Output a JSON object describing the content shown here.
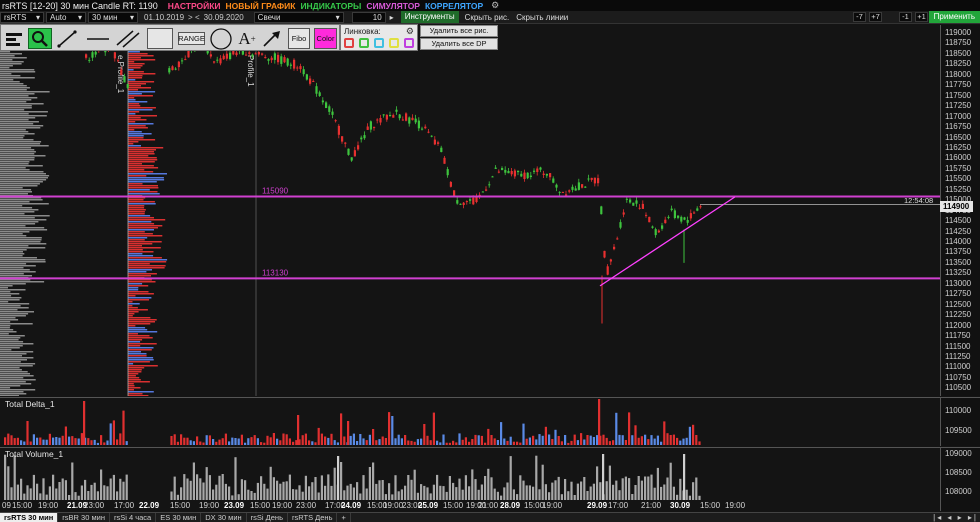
{
  "window": {
    "title": "rsRTS [12-20] 30 мин Candle RT: 1190",
    "menus": [
      {
        "label": "НАСТРОЙКИ",
        "color": "#ff4a8a"
      },
      {
        "label": "НОВЫЙ ГРАФИК",
        "color": "#ff8c1a"
      },
      {
        "label": "ИНДИКАТОРЫ",
        "color": "#36c94a"
      },
      {
        "label": "СИМУЛЯТОР",
        "color": "#d85ad8"
      },
      {
        "label": "КОРРЕЛЯТОР",
        "color": "#3ea6ff"
      }
    ]
  },
  "toolbar": {
    "symbol": "rsRTS",
    "scale_mode": "Auto",
    "timeframe": "30 мин",
    "date_from": "01.10.2019",
    "date_nav": "> <",
    "date_to": "30.09.2020",
    "chart_type": "Свечи",
    "bars_value": "10",
    "tools_button": "Инструменты",
    "hide_drawing": "Скрыть рис.",
    "hide_lines": "Скрыть линии",
    "btn_minus7": "-7",
    "btn_plus7": "+7",
    "btn_minus1": "-1",
    "btn_plus1": "+1",
    "apply_button": "Применить"
  },
  "drawing_panel": {
    "range_label": "RANGE",
    "fibo_label": "Fibo",
    "color_label": "Color",
    "link_title": "Линковка:",
    "link_colors": [
      "#e04040",
      "#40c040",
      "#40c0e0",
      "#e0e040",
      "#c040e0"
    ],
    "delete_drawings": "Удалить все рис.",
    "delete_dp": "Удалить все DP"
  },
  "main_chart": {
    "price_levels": [
      {
        "price": 115090,
        "label": "115090",
        "color": "#d040d0"
      },
      {
        "price": 113130,
        "label": "113130",
        "color": "#d040d0"
      }
    ],
    "current_price": "114900",
    "current_time": "12:54:08",
    "profile_labels": [
      "e Profile_1",
      "Profile_1"
    ],
    "y_ticks": [
      "119000",
      "118750",
      "118500",
      "118250",
      "118000",
      "117750",
      "117500",
      "117250",
      "117000",
      "116750",
      "116500",
      "116250",
      "116000",
      "115750",
      "115500",
      "115250",
      "115000",
      "114750",
      "114500",
      "114250",
      "114000",
      "113750",
      "113500",
      "113250",
      "113000",
      "112750",
      "112500",
      "112250",
      "112000",
      "111750",
      "111500",
      "111250",
      "111000",
      "110750",
      "110500"
    ],
    "up_color": "#3ec43e",
    "down_color": "#e83030"
  },
  "delta_pane": {
    "label": "Total Delta_1",
    "y_ticks": [
      "110000",
      "109500"
    ]
  },
  "volume_pane": {
    "label": "Total Volume_1",
    "y_ticks": [
      "109000",
      "108500",
      "108000"
    ]
  },
  "time_axis": {
    "labels": [
      {
        "text": "09",
        "day": false
      },
      {
        "text": "15:00",
        "day": false
      },
      {
        "text": "19:00",
        "day": false
      },
      {
        "text": "21.09",
        "day": true
      },
      {
        "text": "23:00",
        "day": false
      },
      {
        "text": "17:00",
        "day": false
      },
      {
        "text": "22.09",
        "day": true
      },
      {
        "text": "15:00",
        "day": false
      },
      {
        "text": "19:00",
        "day": false
      },
      {
        "text": "23.09",
        "day": true
      },
      {
        "text": "15:00",
        "day": false
      },
      {
        "text": "19:00",
        "day": false
      },
      {
        "text": "23:00",
        "day": false
      },
      {
        "text": "17:00",
        "day": false
      },
      {
        "text": "24.09",
        "day": true
      },
      {
        "text": "15:00",
        "day": false
      },
      {
        "text": "19:00",
        "day": false
      },
      {
        "text": "23:00",
        "day": false
      },
      {
        "text": "25.09",
        "day": true
      },
      {
        "text": "15:00",
        "day": false
      },
      {
        "text": "19:00",
        "day": false
      },
      {
        "text": "21:00",
        "day": false
      },
      {
        "text": "28.09",
        "day": true
      },
      {
        "text": "15:00",
        "day": false
      },
      {
        "text": "19:00",
        "day": false
      },
      {
        "text": "29.09",
        "day": true
      },
      {
        "text": "17:00",
        "day": false
      },
      {
        "text": "21:00",
        "day": false
      },
      {
        "text": "30.09",
        "day": true
      },
      {
        "text": "15:00",
        "day": false
      },
      {
        "text": "19:00",
        "day": false
      }
    ]
  },
  "tabs": [
    "rsRTS 30 мин",
    "rsBR 30 мин",
    "rsSi 4 часа",
    "ES 30 мин",
    "DX 30 мин",
    "rsSi День",
    "rsRTS День",
    "+"
  ],
  "tab_nav": "|◂ ◂ ▸ ▸|"
}
